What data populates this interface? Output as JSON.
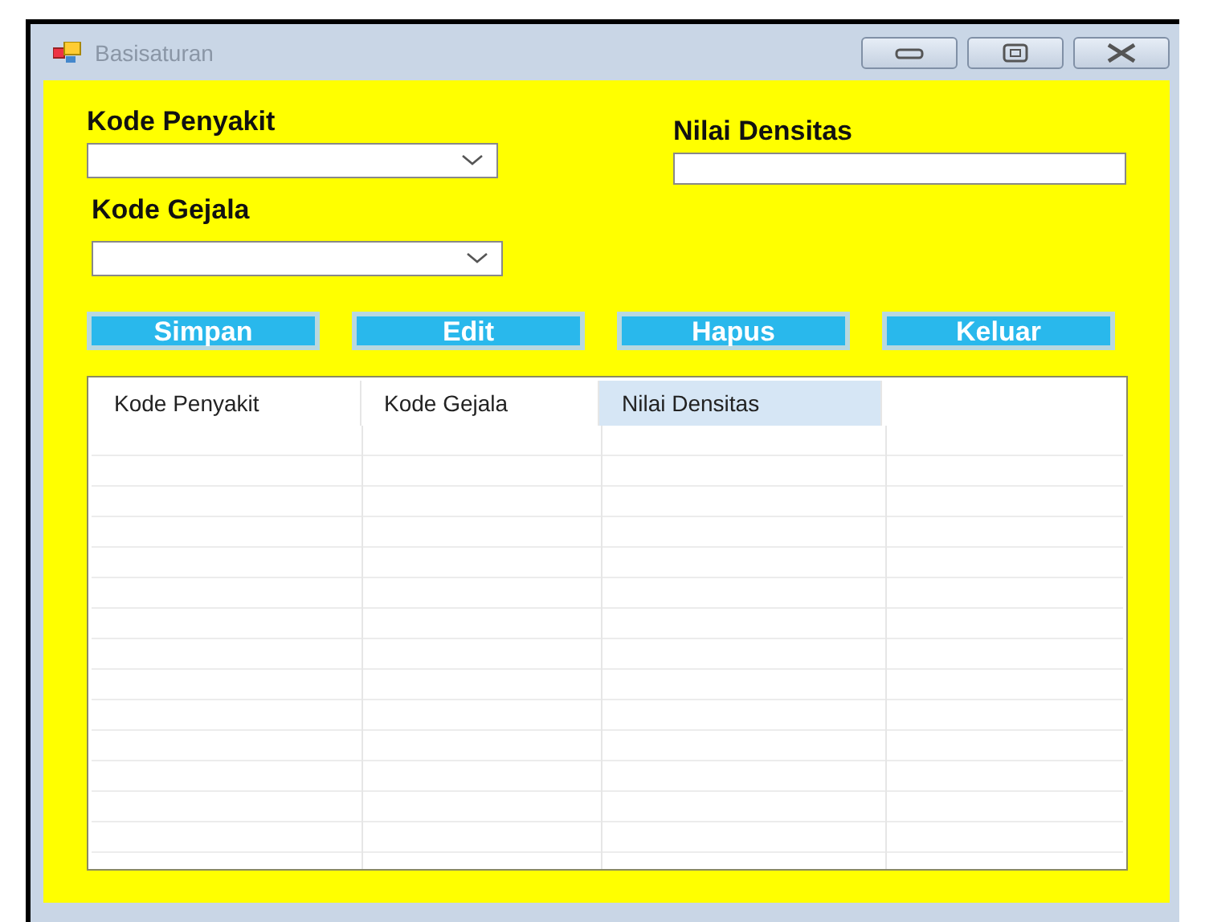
{
  "window": {
    "title": "Basisaturan"
  },
  "fields": [
    {
      "kind": "combo",
      "label": "Kode Penyakit"
    },
    {
      "kind": "text",
      "label": "Nilai Densitas"
    },
    {
      "kind": "combo",
      "label": "Kode Gejala"
    }
  ],
  "buttons": [
    "Simpan",
    "Edit",
    "Hapus",
    "Keluar"
  ],
  "table": {
    "columns": [
      {
        "label": "Kode Penyakit",
        "selected": false
      },
      {
        "label": "Kode Gejala",
        "selected": false
      },
      {
        "label": "Nilai Densitas",
        "selected": true
      }
    ]
  }
}
